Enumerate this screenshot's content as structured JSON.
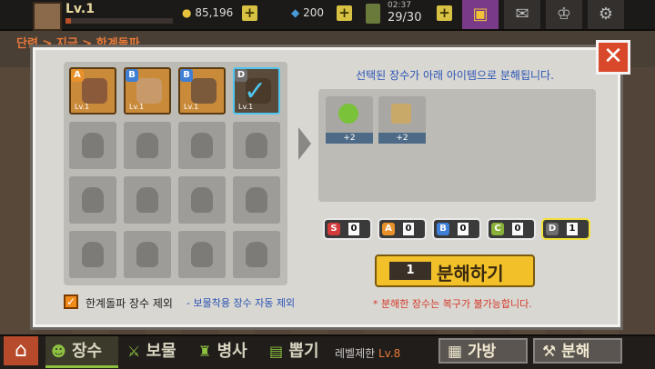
{
  "top_bar": {
    "level": "Lv.1",
    "exp_fraction": 0.05,
    "gold": "85,196",
    "gems": "200",
    "stamina_timer": "02:37",
    "stamina": "29/30",
    "icons": [
      "gift-icon",
      "mail-icon",
      "trophy-icon",
      "gear-icon"
    ]
  },
  "breadcrumb": "단련 > 지금 > 한계돌파",
  "dialog": {
    "info_text": "선택된 장수가 아래 아이템으로 분해됩니다.",
    "heroes": [
      {
        "grade": "A",
        "level": "Lv.1",
        "color": "#e8912a",
        "face": "#8a5a3a"
      },
      {
        "grade": "B",
        "level": "Lv.1",
        "color": "#3f7fd6",
        "face": "#c89a6a"
      },
      {
        "grade": "B",
        "level": "Lv.1",
        "color": "#3f7fd6",
        "face": "#7a5a3a"
      },
      {
        "grade": "D",
        "level": "Lv.1",
        "color": "#6d6d6d",
        "face": "#4a3a2a",
        "selected": true
      }
    ],
    "result_items": [
      {
        "name": "orb-item",
        "count": "+2",
        "color": "#7ac23a"
      },
      {
        "name": "scroll-item",
        "count": "+2",
        "color": "#c9a96a"
      }
    ],
    "grades": [
      {
        "grade": "S",
        "count": "0",
        "color": "#d33a3a",
        "border": "#e8e8e8"
      },
      {
        "grade": "A",
        "count": "0",
        "color": "#e8912a",
        "border": "#e8e8e8"
      },
      {
        "grade": "B",
        "count": "0",
        "color": "#3f7fd6",
        "border": "#e8e8e8"
      },
      {
        "grade": "C",
        "count": "0",
        "color": "#8ab23a",
        "border": "#e8e8e8"
      },
      {
        "grade": "D",
        "count": "1",
        "color": "#6d6d6d",
        "border": "#f2e23a"
      }
    ],
    "decompose_count": "1",
    "decompose_label": "분해하기",
    "warning": "* 분해한 장수는 복구가 불가능합니다.",
    "checkbox_label": "한계돌파 장수 제외",
    "checkbox_note": "- 보물착용 장수 자동 제외"
  },
  "bottom_nav": {
    "tabs": [
      "장수",
      "보물",
      "병사",
      "뽑기"
    ],
    "level_limit_prefix": "레벨제한",
    "level_limit_value": "Lv.8",
    "bag_label": "가방",
    "decompose_label": "분해"
  }
}
